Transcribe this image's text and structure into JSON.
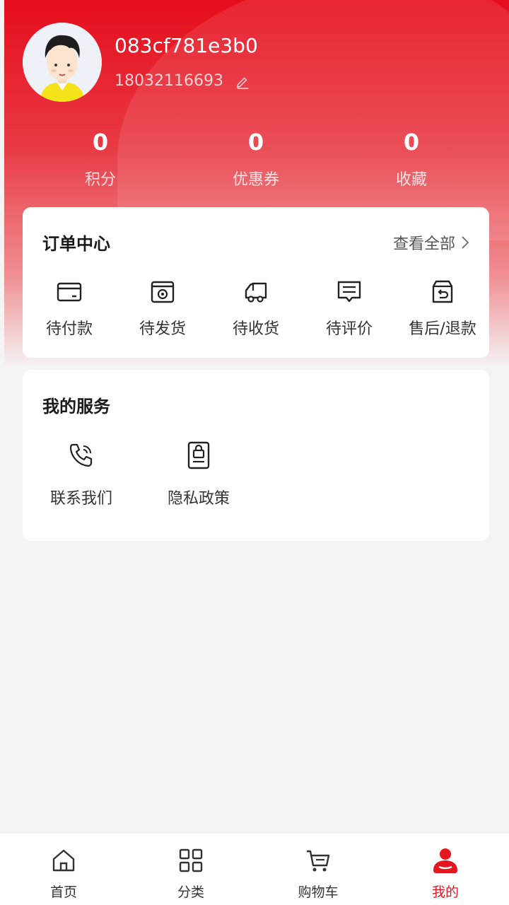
{
  "profile": {
    "username": "083cf781e3b0",
    "phone": "18032116693"
  },
  "stats": [
    {
      "value": "0",
      "label": "积分"
    },
    {
      "value": "0",
      "label": "优惠券"
    },
    {
      "value": "0",
      "label": "收藏"
    }
  ],
  "orders": {
    "title": "订单中心",
    "view_all": "查看全部",
    "items": [
      {
        "label": "待付款",
        "icon": "wallet-icon"
      },
      {
        "label": "待发货",
        "icon": "box-icon"
      },
      {
        "label": "待收货",
        "icon": "truck-icon"
      },
      {
        "label": "待评价",
        "icon": "comment-icon"
      },
      {
        "label": "售后/退款",
        "icon": "return-box-icon"
      }
    ]
  },
  "services": {
    "title": "我的服务",
    "items": [
      {
        "label": "联系我们",
        "icon": "phone-call-icon"
      },
      {
        "label": "隐私政策",
        "icon": "privacy-lock-icon"
      }
    ]
  },
  "tabbar": {
    "items": [
      {
        "label": "首页",
        "icon": "home-icon"
      },
      {
        "label": "分类",
        "icon": "grid-icon"
      },
      {
        "label": "购物车",
        "icon": "cart-icon"
      },
      {
        "label": "我的",
        "icon": "user-icon"
      }
    ],
    "active_index": 3
  },
  "colors": {
    "brand_red": "#e5161f",
    "background": "#f4f4f4"
  }
}
